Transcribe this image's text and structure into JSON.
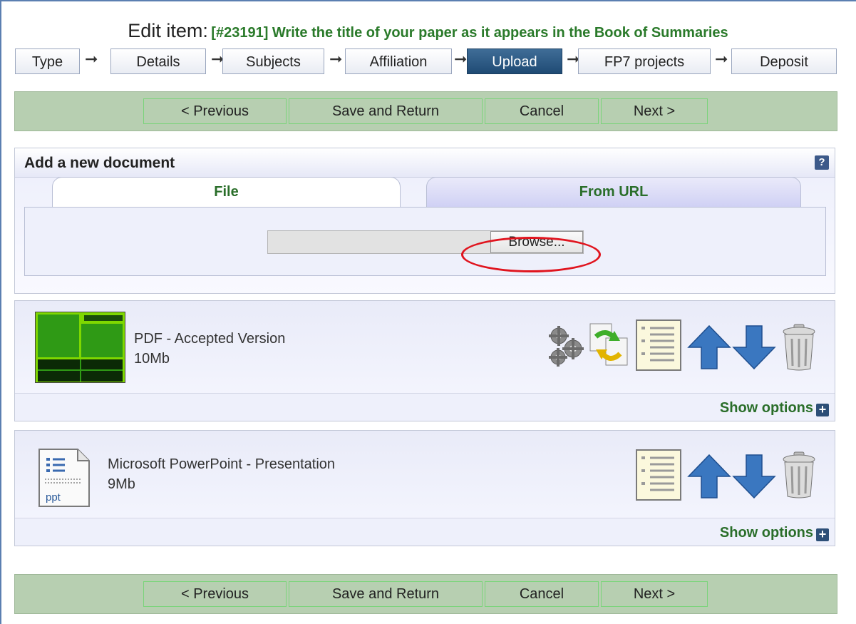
{
  "header": {
    "label": "Edit item:",
    "item_title": "[#23191] Write the title of your paper as it appears in the Book of Summaries"
  },
  "stages": [
    {
      "label": "Type",
      "active": false
    },
    {
      "label": "Details",
      "active": false
    },
    {
      "label": "Subjects",
      "active": false
    },
    {
      "label": "Affiliation",
      "active": false
    },
    {
      "label": "Upload",
      "active": true
    },
    {
      "label": "FP7 projects",
      "active": false
    },
    {
      "label": "Deposit",
      "active": false
    }
  ],
  "nav_buttons": {
    "previous": "< Previous",
    "save_return": "Save and Return",
    "cancel": "Cancel",
    "next": "Next >"
  },
  "add_document": {
    "title": "Add a new document",
    "help": "?",
    "tabs": [
      {
        "label": "File",
        "active": true
      },
      {
        "label": "From URL",
        "active": false
      }
    ],
    "browse_label": "Browse..."
  },
  "documents": [
    {
      "name": "PDF - Accepted Version",
      "size": "10Mb",
      "icons": [
        "gears-icon",
        "convert-icon",
        "document-details-icon",
        "move-up-icon",
        "move-down-icon",
        "trash-icon"
      ],
      "show_options": "Show options"
    },
    {
      "name": "Microsoft PowerPoint - Presentation",
      "size": "9Mb",
      "thumb_label": "ppt",
      "icons": [
        "document-details-icon",
        "move-up-icon",
        "move-down-icon",
        "trash-icon"
      ],
      "show_options": "Show options"
    }
  ],
  "colors": {
    "bar_green": "#b7cfb1",
    "link_green": "#2a6e2a",
    "active_stage": "#1f4b74",
    "highlight_red": "#e0141e"
  }
}
